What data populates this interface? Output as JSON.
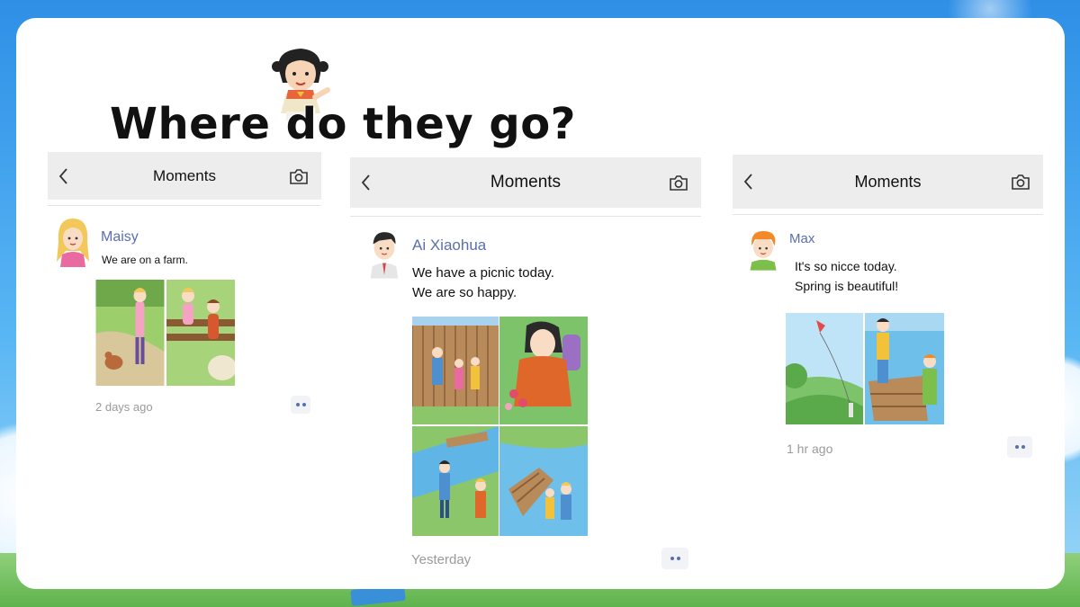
{
  "slide": {
    "title": "Where do they go?"
  },
  "panels": [
    {
      "header": {
        "title": "Moments",
        "back_icon": "chevron-left-icon",
        "camera_icon": "camera-icon"
      },
      "post": {
        "author": "Maisy",
        "lines": [
          "We are on a farm."
        ],
        "time": "2 days ago",
        "photos": [
          "farm girls with sheep and chicken",
          "two girls on a fence"
        ]
      }
    },
    {
      "header": {
        "title": "Moments",
        "back_icon": "chevron-left-icon",
        "camera_icon": "camera-icon"
      },
      "post": {
        "author": "Ai Xiaohua",
        "lines": [
          "We have a picnic today.",
          "We are so happy."
        ],
        "time": "Yesterday",
        "photos": [
          "family walking by fence",
          "girl picking flowers",
          "boy by a stream bridge",
          "boat on the river"
        ]
      }
    },
    {
      "header": {
        "title": "Moments",
        "back_icon": "chevron-left-icon",
        "camera_icon": "camera-icon"
      },
      "post": {
        "author": "Max",
        "lines": [
          "It's so nicce today.",
          "Spring is beautiful!"
        ],
        "time": "1 hr ago",
        "photos": [
          "kite over green hills",
          "two boys in a boat"
        ]
      }
    }
  ],
  "colors": {
    "author": "#5a6fb0",
    "header_bg": "#ededed",
    "card_bg": "#ffffff",
    "sky": "#2f8fe6"
  }
}
